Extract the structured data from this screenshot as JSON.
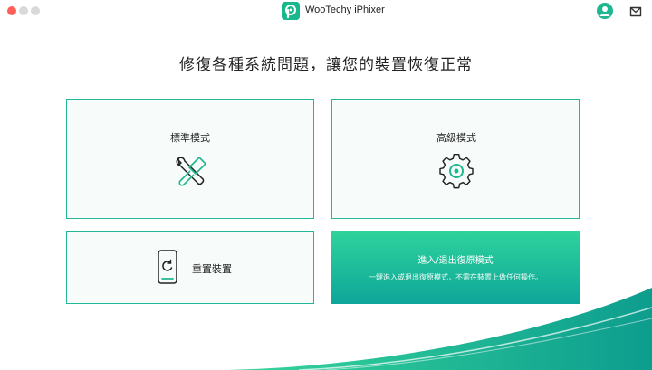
{
  "window": {
    "title": "WooTechy iPhixer",
    "logo_icon": "app-logo-icon",
    "controls": [
      "close",
      "minimize",
      "zoom"
    ]
  },
  "header": {
    "profile_icon": "user-avatar-icon",
    "mail_icon": "mail-icon"
  },
  "main": {
    "headline": "修復各種系統問題，讓您的裝置恢復正常",
    "cards": {
      "standard": {
        "label": "標準模式",
        "icon": "wrench-screwdriver-icon"
      },
      "advanced": {
        "label": "高級模式",
        "icon": "gear-icon"
      },
      "reset": {
        "label": "重置裝置",
        "icon": "phone-reset-icon"
      },
      "dfu": {
        "label": "進入/退出復原模式",
        "description": "一鍵進入或退出復原模式，不需在裝置上做任何操作。",
        "icon": ""
      }
    }
  },
  "colors": {
    "accent": "#23b79a",
    "card_bg": "#f7fcfb",
    "dfu_gradient_top": "#2ed39b",
    "dfu_gradient_bottom": "#0ea69a",
    "close_dot": "#ff5f57"
  }
}
